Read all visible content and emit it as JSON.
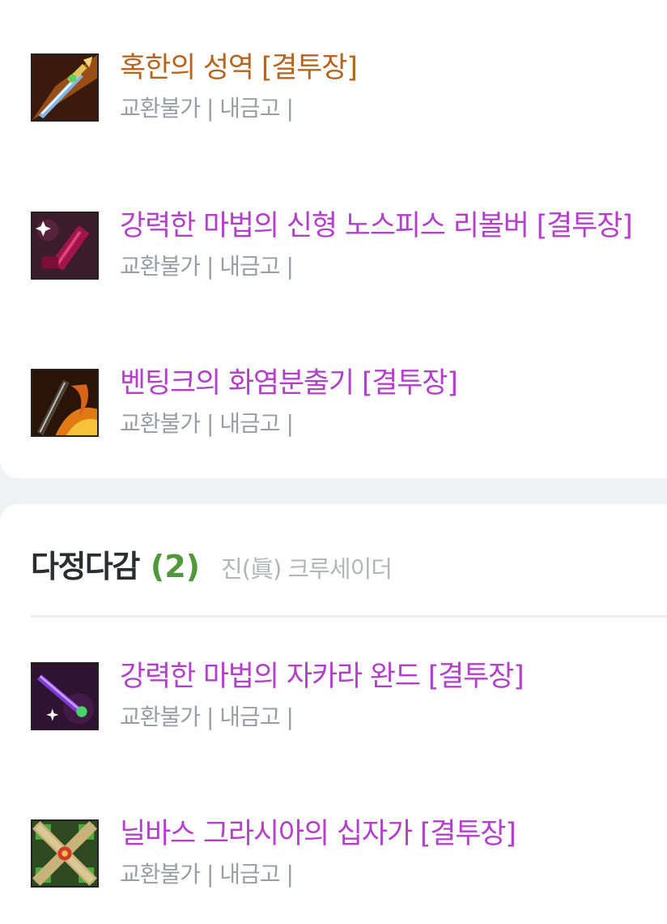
{
  "colors": {
    "epic_name": "#b5651d",
    "unique_name": "#b340c9",
    "count_green": "#4e9a3a",
    "sub_text": "#9a9da3"
  },
  "top_items": [
    {
      "name": "혹한의 성역 [결투장]",
      "grade": "epic",
      "icon": "ice-sword-icon",
      "sub": "교환불가 | 내금고 |"
    },
    {
      "name": "강력한 마법의 신형 노스피스 리볼버 [결투장]",
      "grade": "unique",
      "icon": "revolver-icon",
      "sub": "교환불가 | 내금고 |"
    },
    {
      "name": "벤팅크의 화염분출기 [결투장]",
      "grade": "unique",
      "icon": "flamethrower-icon",
      "sub": "교환불가 | 내금고 |"
    }
  ],
  "set": {
    "title": "다정다감",
    "count": "(2)",
    "class": "진(眞) 크루세이더"
  },
  "set_items": [
    {
      "name": "강력한 마법의 자카라 완드 [결투장]",
      "grade": "unique",
      "icon": "wand-icon",
      "sub": "교환불가 | 내금고 |"
    },
    {
      "name": "닐바스 그라시아의 십자가 [결투장]",
      "grade": "unique",
      "icon": "cross-icon",
      "sub": "교환불가 | 내금고 |"
    }
  ]
}
